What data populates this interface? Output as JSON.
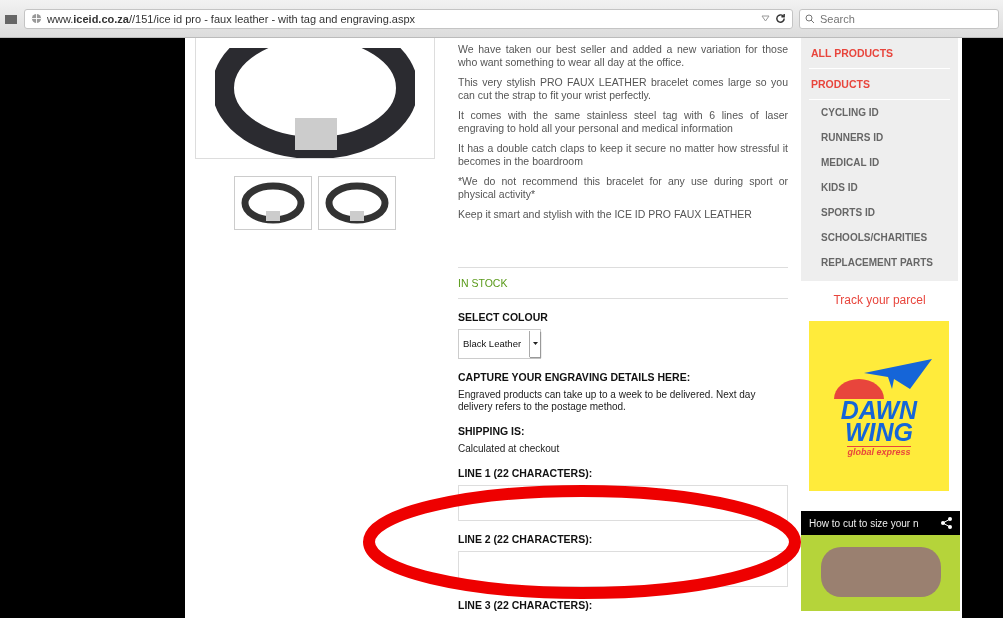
{
  "browser": {
    "url": "www.**iceid.co.za**//151/ice id pro - faux leather - with tag and engraving.aspx",
    "search": {
      "placeholder": "Search"
    }
  },
  "product": {
    "description": [
      "We have taken our best seller and added a new variation for those who want something to wear all day at the office.",
      "This very stylish PRO FAUX LEATHER bracelet comes large so you can cut the strap to fit your wrist perfectly.",
      "It comes with the same stainless steel tag with 6 lines of laser engraving to hold all your personal and medical information",
      "It has a double catch claps to keep it secure no matter how stressful it becomes in the boardroom",
      "*We do not recommend this bracelet for any use during sport or physical activity*",
      "Keep it smart and stylish with the ICE ID PRO FAUX LEATHER"
    ],
    "stock": "IN STOCK",
    "colour": {
      "label": "SELECT COLOUR",
      "value": "Black Leather"
    },
    "engraving": {
      "heading": "CAPTURE YOUR ENGRAVING DETAILS HERE:",
      "note": "Engraved products can take up to a week to be delivered. Next day delivery refers to the postage method."
    },
    "shipping": {
      "heading": "SHIPPING IS:",
      "text": "Calculated at checkout"
    },
    "lines": [
      {
        "label": "LINE 1 (22 CHARACTERS):",
        "kind": "field"
      },
      {
        "label": "LINE 2 (22 CHARACTERS):",
        "kind": "field"
      },
      {
        "label": "LINE 3 (22 CHARACTERS):",
        "kind": "label"
      }
    ]
  },
  "sidebar": {
    "items": [
      {
        "label": "ALL PRODUCTS"
      },
      {
        "label": "PRODUCTS",
        "children": [
          {
            "label": "CYCLING ID"
          },
          {
            "label": "RUNNERS ID"
          },
          {
            "label": "MEDICAL ID"
          },
          {
            "label": "KIDS ID"
          },
          {
            "label": "SPORTS ID"
          },
          {
            "label": "SCHOOLS/CHARITIES"
          },
          {
            "label": "REPLACEMENT PARTS"
          }
        ]
      }
    ],
    "track_link": "Track your parcel",
    "courier_logo": {
      "name_lines": [
        "DAWN",
        "WING"
      ],
      "tagline": "global express"
    },
    "video": {
      "title": "How to cut to size your n"
    }
  }
}
